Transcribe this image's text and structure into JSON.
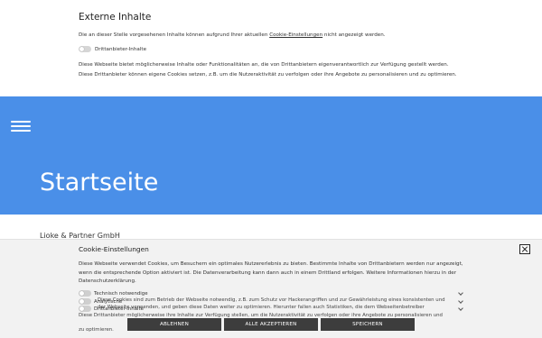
{
  "external": {
    "title": "Externe Inhalte",
    "line1_before": "Die an dieser Stelle vorgesehenen Inhalte können aufgrund Ihrer aktuellen ",
    "line1_link": "Cookie-Einstellungen",
    "line1_after": " nicht angezeigt werden.",
    "toggle_label": "Drittanbieter-Inhalte",
    "paragraph": "Diese Webseite bietet möglicherweise Inhalte oder Funktionalitäten an, die von Drittanbietern eigenverantwortlich zur Verfügung gestellt werden. Diese Drittanbieter können eigene Cookies setzen, z.B. um die Nutzeraktivität zu verfolgen oder ihre Angebote zu personalisieren und zu optimieren."
  },
  "hero": {
    "title": "Startseite",
    "color": "#4a8fe8"
  },
  "content_peek": "Lioke & Partner GmbH",
  "cookie": {
    "title": "Cookie-Einstellungen",
    "paragraph": "Diese Webseite verwendet Cookies, um Besuchern ein optimales Nutzererlebnis zu bieten. Bestimmte Inhalte von Drittanbietern werden nur angezeigt, wenn die entsprechende Option aktiviert ist. Die Datenverarbeitung kann dann auch in einem Drittland erfolgen. Weitere Informationen hierzu in der Datenschutzerklärung.",
    "options": [
      {
        "label": "Technisch notwendige"
      },
      {
        "label": "Analytische"
      },
      {
        "label": "Drittanbieter-Inhalte"
      }
    ],
    "details": [
      "Diese Cookies sind zum Betrieb der Webseite notwendig, z.B. zum Schutz vor Hackerangriffen und zur Gewährleistung eines konsistenten und",
      "der Webseite verwenden, und geben diese Daten weiter zu optimieren. Hierunter fallen auch Statistiken, die dem Webseitenbetreiber",
      "Diese Drittanbieter möglicherweise ihre Inhalte zur Verfügung stellen, um die Nutzeraktivität zu verfolgen oder ihre Angebote zu personalisieren und",
      "zu optimieren."
    ],
    "buttons": {
      "reject": "ABLEHNEN",
      "accept_all": "ALLE AKZEPTIEREN",
      "save": "SPEICHERN"
    }
  }
}
